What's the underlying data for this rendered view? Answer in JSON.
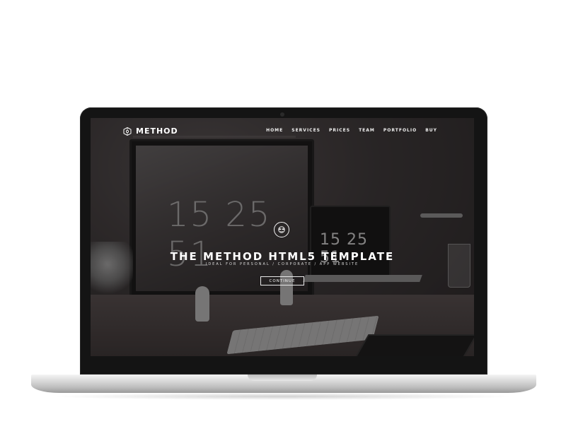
{
  "site": {
    "logo_text": "METHOD",
    "logo_icon": "hexagon-logo-icon"
  },
  "nav": {
    "items": [
      {
        "label": "HOME"
      },
      {
        "label": "SERVICES"
      },
      {
        "label": "PRICES"
      },
      {
        "label": "TEAM"
      },
      {
        "label": "PORTFOLIO"
      },
      {
        "label": "BUY"
      }
    ]
  },
  "hero": {
    "emblem_icon": "face-emblem-icon",
    "title": "THE METHOD HTML5 TEMPLATE",
    "subtitle": "IDEAL FOR PERSONAL / CORPORATE / APP WEBSITE",
    "button_label": "CONTINUE"
  },
  "background_photo": {
    "monitor_clock": "15 25 51",
    "laptop_clock": "15 25 51"
  },
  "colors": {
    "overlay": "#141213",
    "text": "#ffffff",
    "laptop_bezel": "#141414",
    "laptop_base": "#d9d9d9"
  }
}
